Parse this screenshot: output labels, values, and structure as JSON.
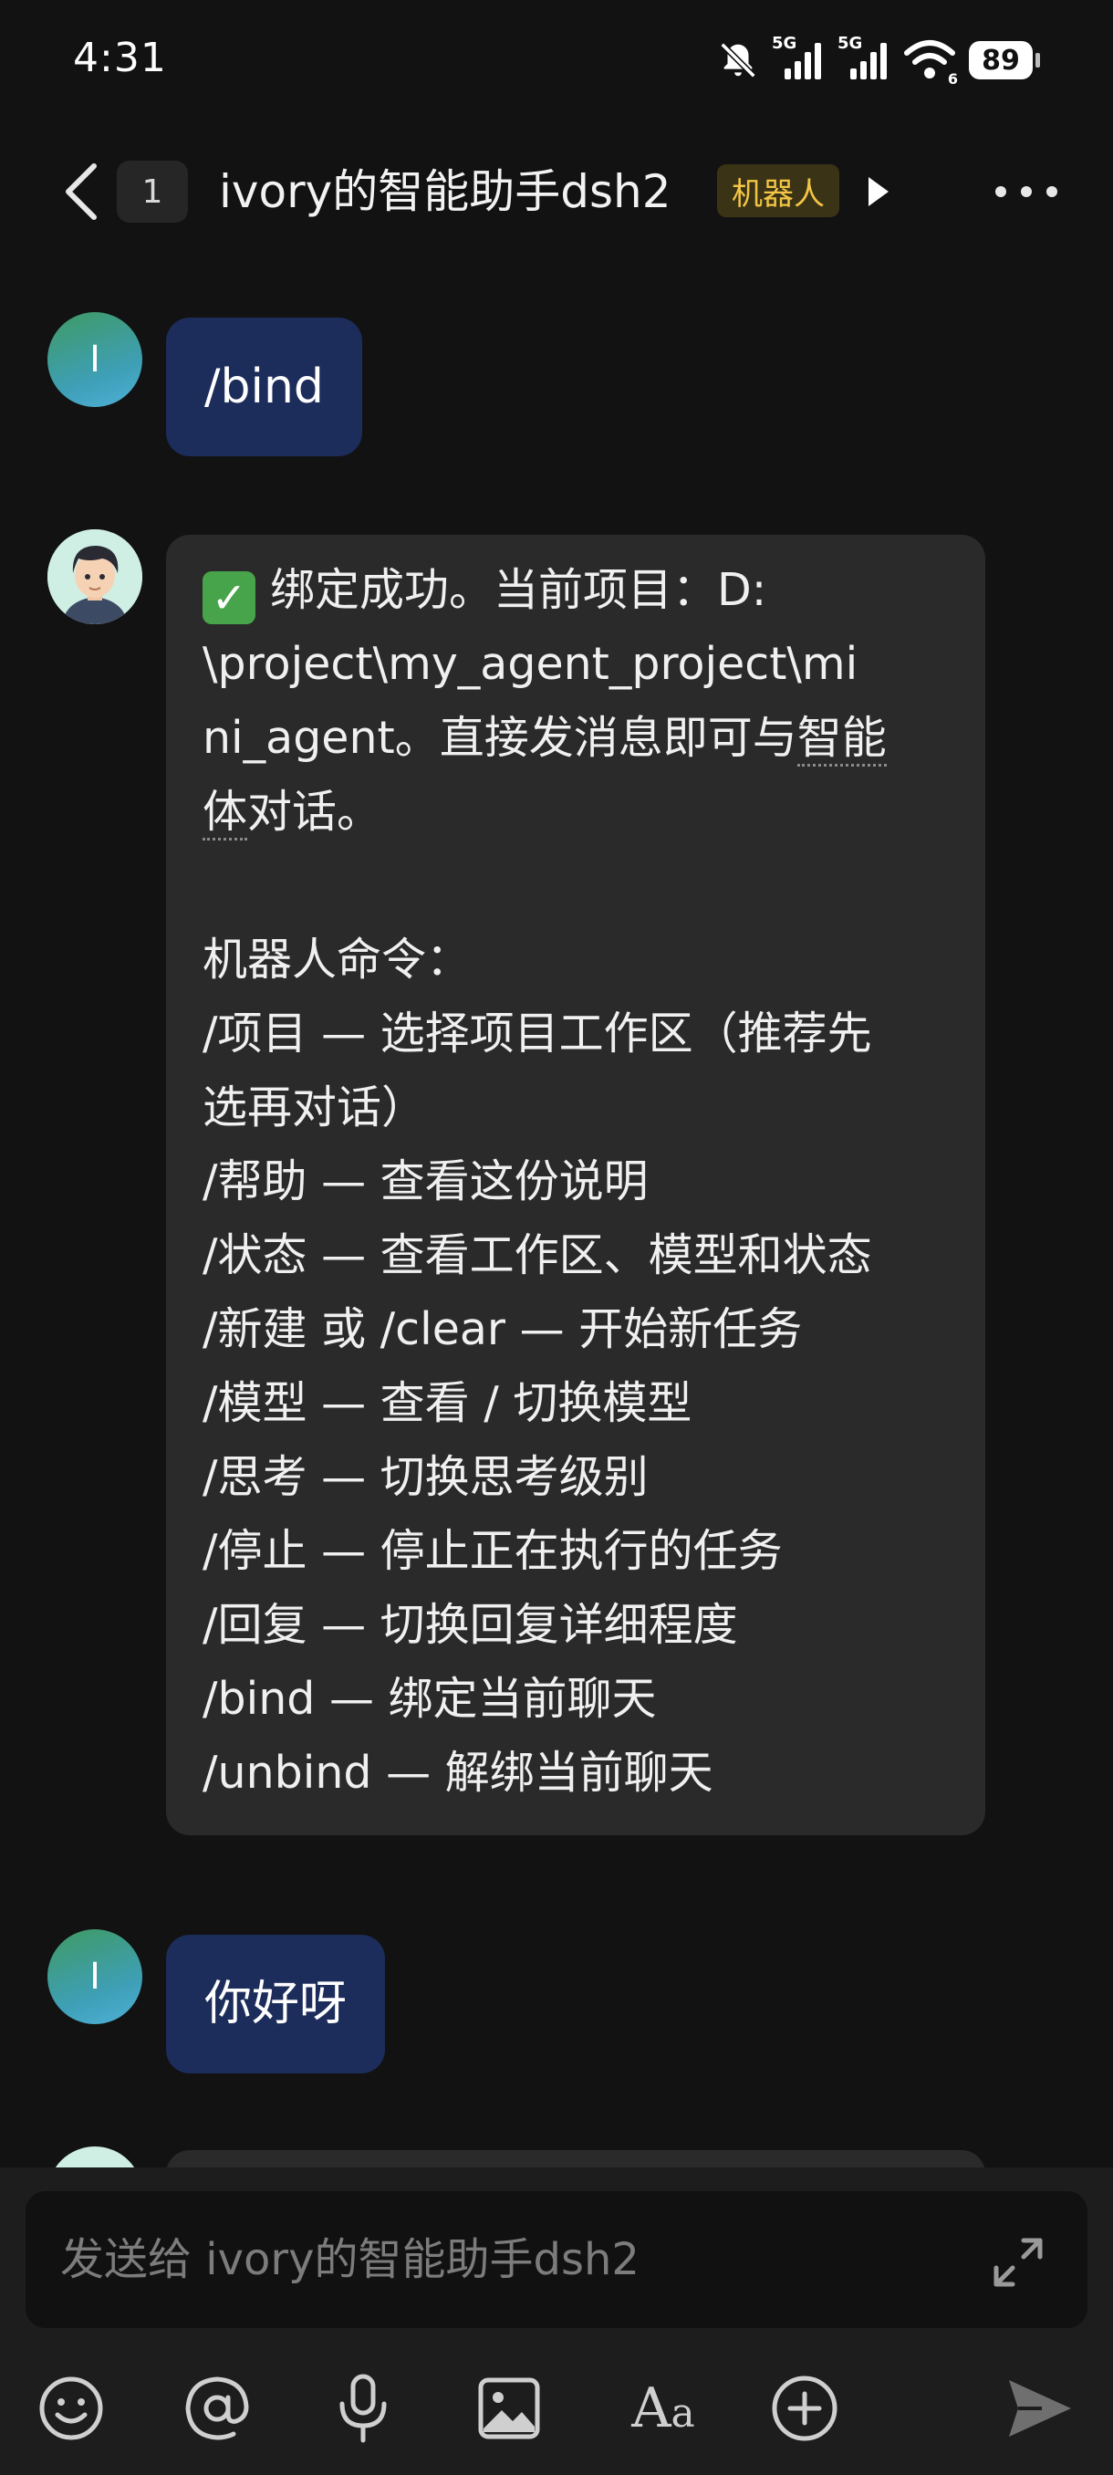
{
  "status_bar": {
    "time": "4:31",
    "signal1": "5G",
    "signal2": "5G",
    "wifi_level": "6",
    "battery": "89"
  },
  "header": {
    "unread_count": "1",
    "title": "ivory的智能助手dsh2",
    "bot_tag": "机器人"
  },
  "messages": [
    {
      "sender": "user",
      "avatar_initial": "I",
      "text": "/bind"
    },
    {
      "sender": "bot",
      "check": "✓",
      "lines": [
        "绑定成功。当前项目：D:",
        "\\project\\my_agent_project\\mi",
        "ni_agent。直接发消息即可与",
        "智能",
        "体",
        "对话。",
        "",
        "机器人命令：",
        "/项目 — 选择项目工作区（推荐先",
        "选再对话）",
        "/帮助 — 查看这份说明",
        "/状态 — 查看工作区、模型和状态",
        "/新建 或 /clear — 开始新任务",
        "/模型 — 查看 / 切换模型",
        "/思考 — 切换思考级别",
        "/停止 — 停止正在执行的任务",
        "/回复 — 切换回复详细程度",
        "/bind — 绑定当前聊天",
        "/unbind — 解绑当前聊天"
      ]
    },
    {
      "sender": "user",
      "avatar_initial": "I",
      "text": "你好呀"
    }
  ],
  "input": {
    "placeholder": "发送给 ivory的智能助手dsh2"
  },
  "toolbar": {
    "icons": [
      "emoji-icon",
      "mention-icon",
      "microphone-icon",
      "image-icon",
      "font-icon",
      "plus-icon",
      "send-icon"
    ],
    "font_label_big": "A",
    "font_label_small": "a"
  },
  "colors": {
    "background": "#121212",
    "user_bubble": "#1c2d5b",
    "bot_bubble": "#2a2a2a",
    "bot_tag_text": "#f3c545",
    "bot_tag_bg": "#3a3316"
  }
}
